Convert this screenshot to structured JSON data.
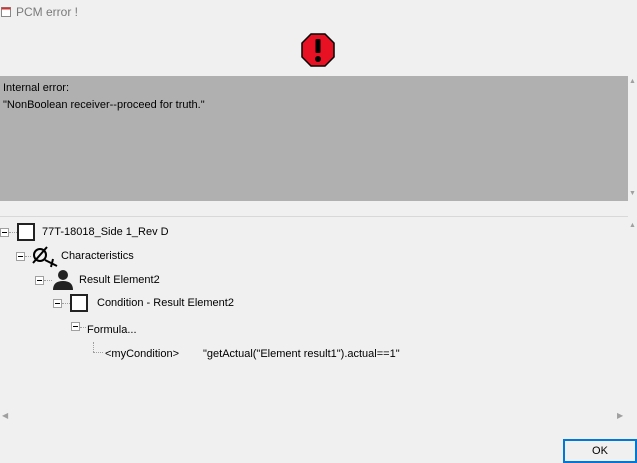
{
  "window": {
    "title": "PCM error !"
  },
  "icons": {
    "app": "app-window-icon",
    "alert": "error-stop-icon",
    "alert_color": "#e81123"
  },
  "message": {
    "line1": "Internal error:",
    "line2": "\"NonBoolean receiver--proceed for truth.\""
  },
  "tree": {
    "root": "77T-18018_Side 1_Rev D",
    "characteristics": "Characteristics",
    "result_element": "Result Element2",
    "condition": "Condition - Result Element2",
    "formula": "Formula...",
    "condition_tag": "<myCondition>",
    "condition_expr": "\"getActual(\"Element result1\").actual==1\""
  },
  "buttons": {
    "ok": "OK"
  },
  "colors": {
    "message_bg": "#b0b0b0",
    "button_border": "#0078d7"
  }
}
